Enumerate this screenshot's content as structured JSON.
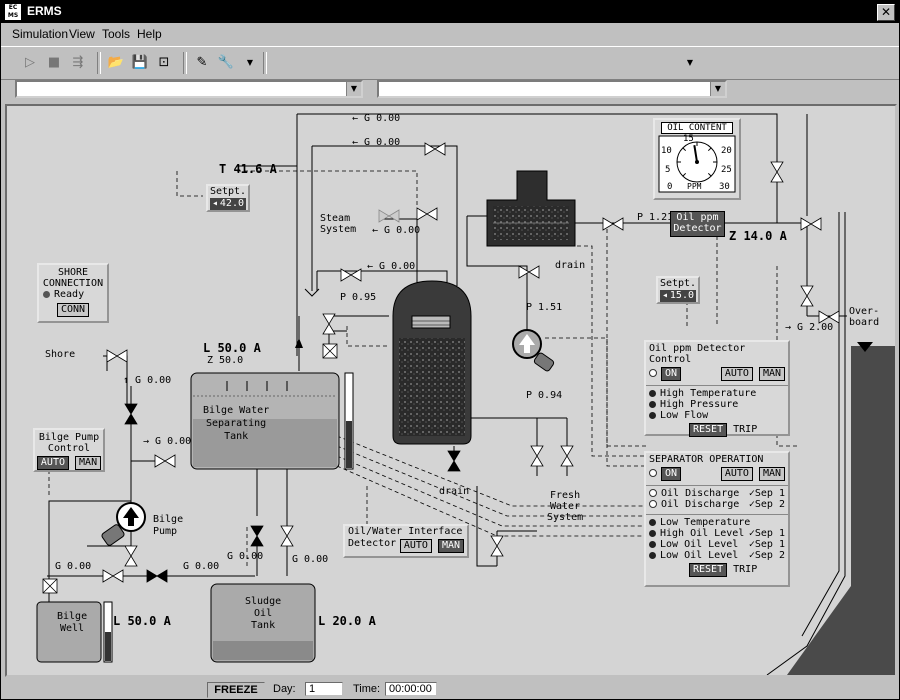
{
  "window": {
    "title": "ERMS",
    "icon": "ecms-app-icon",
    "close_label": "✕"
  },
  "menu": {
    "items": [
      "Simulation",
      "View",
      "Tools",
      "Help"
    ]
  },
  "toolbar": {
    "icons": [
      "play-icon",
      "stop-icon",
      "speed-icon",
      "open-icon",
      "save-icon",
      "snapshot-icon",
      "pen-icon",
      "wrench-icon"
    ]
  },
  "selectors": {
    "left_value": "",
    "right_value": ""
  },
  "flow_labels": {
    "g_top1": "← G 0.00",
    "g_top2": "← G 0.00",
    "steam_g": "← G 0.00",
    "g_mid": "← G 0.00",
    "p095": "P 0.95",
    "p121": "P 1.21",
    "p151": "P 1.51",
    "p094": "P 0.94",
    "shore_g": "↑ G 0.00",
    "pump_g": "→ G 0.00",
    "well_g1": "G 0.00",
    "well_g2": "G 0.00",
    "sludge_g1": "G 0.00",
    "sludge_g2": "G 0.00",
    "overboard_g": "→ G 2.00",
    "z_label": "Z 50.0"
  },
  "readouts": {
    "t_temp": "T 41.6  A",
    "l_sep": "L 50.0  A",
    "l_well": "L 50.0  A",
    "l_sludge": "L 20.0  A",
    "z_ppm": "Z 14.0  A"
  },
  "labels": {
    "steam": "Steam\nSystem",
    "shore": "Shore",
    "drain1": "drain",
    "drain2": "drain",
    "fresh": "Fresh\nWater\nSystem",
    "overboard": "Over-\nboard",
    "sep_tank": "Bilge Water\nSeparating\nTank",
    "well": "Bilge\nWell",
    "sludge": "Sludge\nOil\nTank",
    "bilge_pump": "Bilge\nPump",
    "detector": "Oil ppm\nDetector"
  },
  "setpoints": {
    "temp": {
      "title": "Setpt.",
      "value": "42.0"
    },
    "ppm": {
      "title": "Setpt.",
      "value": "15.0"
    }
  },
  "shore_panel": {
    "title": "SHORE\nCONNECTION",
    "status": "Ready",
    "button": "CONN"
  },
  "bilge_ctrl": {
    "title": "Bilge Pump\nControl",
    "auto": "AUTO",
    "man": "MAN"
  },
  "interface_det": {
    "title": "Oil/Water Interface\nDetector",
    "auto": "AUTO",
    "man": "MAN"
  },
  "gauge": {
    "title": "OIL CONTENT",
    "unit": "PPM",
    "ticks": [
      "0",
      "5",
      "10",
      "15",
      "20",
      "25",
      "30"
    ],
    "value": 14
  },
  "ppm_ctrl": {
    "title": "Oil ppm Detector Control",
    "on": "ON",
    "auto": "AUTO",
    "man": "MAN",
    "alarms": [
      "High Temperature",
      "High Pressure",
      "Low Flow"
    ],
    "reset": "RESET",
    "trip": "TRIP"
  },
  "sep_op": {
    "title": "SEPARATOR OPERATION",
    "on": "ON",
    "auto": "AUTO",
    "man": "MAN",
    "discharge": [
      {
        "label": "Oil Discharge",
        "sep": "✓Sep 1"
      },
      {
        "label": "Oil Discharge",
        "sep": "✓Sep 2"
      }
    ],
    "alarms": [
      {
        "label": "Low Temperature",
        "sep": ""
      },
      {
        "label": "High Oil Level",
        "sep": "✓Sep 1"
      },
      {
        "label": "Low Oil Level",
        "sep": "✓Sep 1"
      },
      {
        "label": "Low Oil Level",
        "sep": "✓Sep 2"
      }
    ],
    "reset": "RESET",
    "trip": "TRIP"
  },
  "status": {
    "freeze": "FREEZE",
    "day_label": "Day:",
    "day_value": "1",
    "time_label": "Time:",
    "time_value": "00:00:00"
  }
}
